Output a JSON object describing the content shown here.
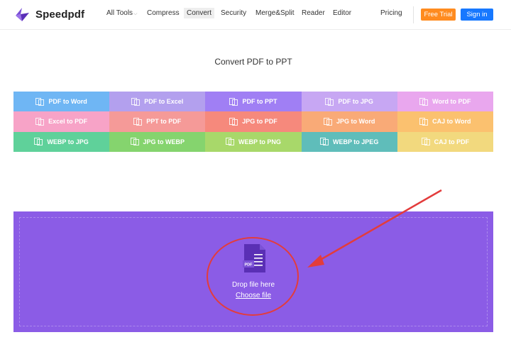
{
  "header": {
    "brand": "Speedpdf",
    "nav": [
      {
        "label": "All Tools",
        "caret": "⌵"
      },
      {
        "label": "Compress"
      },
      {
        "label": "Convert",
        "active": true
      },
      {
        "label": "Security"
      },
      {
        "label": "Merge&Split"
      },
      {
        "label": "Reader"
      },
      {
        "label": "Editor"
      },
      {
        "label": "Pricing"
      }
    ],
    "free_trial": "Free Trial",
    "sign_in": "Sign in",
    "colors": {
      "brand_purple": "#6b3fc6",
      "trial": "#ff8b1f",
      "signin": "#1778ff"
    }
  },
  "title": "Convert PDF to PPT",
  "tools": [
    {
      "label": "PDF to Word",
      "color": "#6fb6f4"
    },
    {
      "label": "PDF to Excel",
      "color": "#b3a0ee"
    },
    {
      "label": "PDF to PPT",
      "color": "#a07ff4"
    },
    {
      "label": "PDF to JPG",
      "color": "#c7a7f3"
    },
    {
      "label": "Word to PDF",
      "color": "#e9a7ee"
    },
    {
      "label": "Excel to PDF",
      "color": "#f7a3c7"
    },
    {
      "label": "PPT to PDF",
      "color": "#f59a98"
    },
    {
      "label": "JPG to PDF",
      "color": "#f6897c"
    },
    {
      "label": "JPG to Word",
      "color": "#f9aa77"
    },
    {
      "label": "CAJ to Word",
      "color": "#fbc16f"
    },
    {
      "label": "WEBP to JPG",
      "color": "#5fd19a"
    },
    {
      "label": "JPG to WEBP",
      "color": "#85d46e"
    },
    {
      "label": "WEBP to PNG",
      "color": "#a8d86a"
    },
    {
      "label": "WEBP to JPEG",
      "color": "#5fbdba"
    },
    {
      "label": "CAJ to PDF",
      "color": "#f2d97e"
    }
  ],
  "dropzone": {
    "file_badge": "PDF",
    "drop_text": "Drop file here",
    "choose_text": "Choose file",
    "background": "#8b5ce6"
  }
}
